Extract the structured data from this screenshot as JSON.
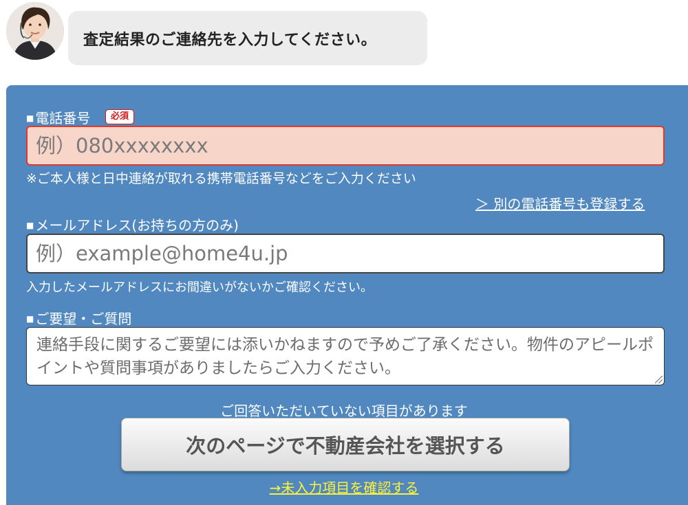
{
  "header": {
    "message": "査定結果のご連絡先を入力してください。"
  },
  "phone": {
    "label": "電話番号",
    "required_badge": "必須",
    "placeholder": "例）080xxxxxxxx",
    "note": "※ご本人様と日中連絡が取れる携帯電話番号などをご入力ください",
    "add_link": "＞ 別の電話番号も登録する"
  },
  "email": {
    "label": "メールアドレス(お持ちの方のみ)",
    "placeholder": "例）example@home4u.jp",
    "note": "入力したメールアドレスにお間違いがないかご確認ください。"
  },
  "request": {
    "label": "ご要望・ご質問",
    "placeholder": "連絡手段に関するご要望には添いかねますので予めご了承ください。物件のアピールポイントや質問事項がありましたらご入力ください。"
  },
  "footer": {
    "unanswered_note": "ご回答いただいていない項目があります",
    "next_button": "次のページで不動産会社を選択する",
    "confirm_link": "→未入力項目を確認する"
  },
  "colors": {
    "panel": "#5088bf",
    "error_border": "#e0392a",
    "error_bg": "#f8d5c9",
    "link_yellow": "#fff23a"
  }
}
